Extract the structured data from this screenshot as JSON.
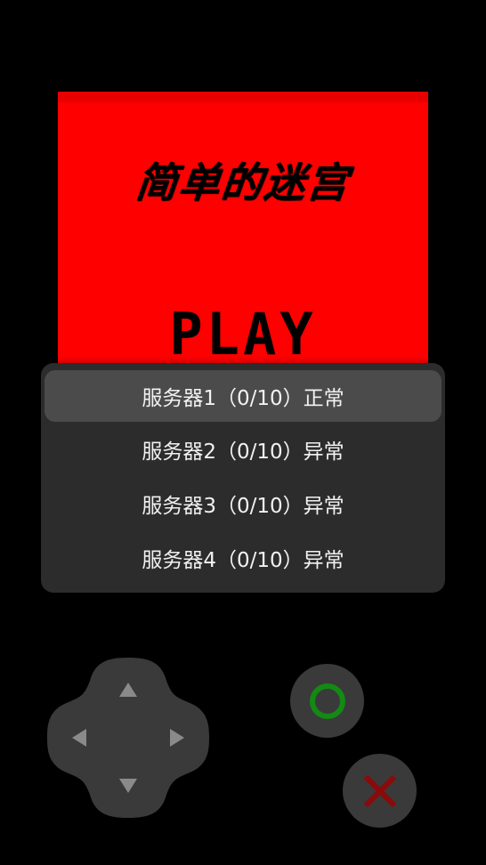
{
  "game": {
    "title": "简单的迷宫",
    "play_label": "PLAY",
    "screen_color": "#ff0000"
  },
  "server_menu": {
    "items": [
      {
        "label": "服务器1（0/10）正常",
        "selected": true
      },
      {
        "label": "服务器2（0/10）异常",
        "selected": false
      },
      {
        "label": "服务器3（0/10）异常",
        "selected": false
      },
      {
        "label": "服务器4（0/10）异常",
        "selected": false
      }
    ]
  },
  "controls": {
    "dpad": {
      "up_icon": "triangle-up-icon",
      "down_icon": "triangle-down-icon",
      "left_icon": "triangle-left-icon",
      "right_icon": "triangle-right-icon"
    },
    "ok_button": {
      "icon": "circle-icon",
      "color": "#138a13"
    },
    "cancel_button": {
      "icon": "cross-icon",
      "color": "#8b0a0a"
    },
    "button_color": "#3a3a3a",
    "arrow_color": "#8a8a8a"
  }
}
